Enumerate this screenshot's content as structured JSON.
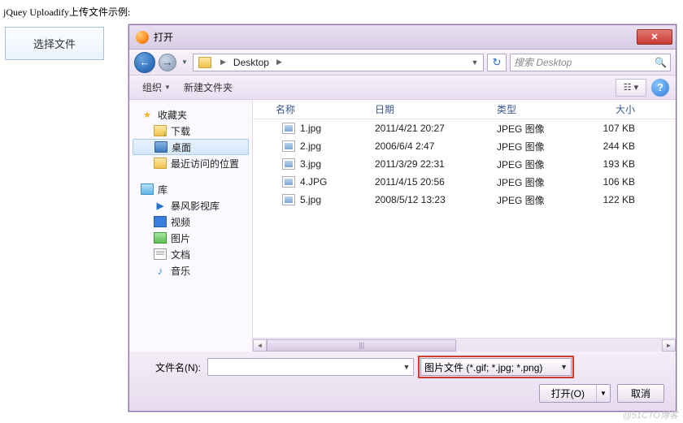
{
  "page_title": "jQuey Uploadify上传文件示例:",
  "select_button": "选择文件",
  "dialog": {
    "title": "打开",
    "close_glyph": "✕",
    "nav_back_glyph": "←",
    "nav_fwd_glyph": "→",
    "breadcrumb": {
      "location": "Desktop"
    },
    "refresh_glyph": "↻",
    "search_placeholder": "搜索 Desktop",
    "search_icon": "🔍"
  },
  "toolbar": {
    "organize": "组织",
    "new_folder": "新建文件夹",
    "view_glyph": "☷ ▾",
    "help_glyph": "?"
  },
  "sidebar": {
    "favorites": {
      "label": "收藏夹",
      "items": [
        {
          "key": "downloads",
          "label": "下载"
        },
        {
          "key": "desktop",
          "label": "桌面",
          "selected": true
        },
        {
          "key": "recent",
          "label": "最近访问的位置"
        }
      ]
    },
    "libraries": {
      "label": "库",
      "items": [
        {
          "key": "storm",
          "label": "暴风影视库"
        },
        {
          "key": "videos",
          "label": "视频"
        },
        {
          "key": "pictures",
          "label": "图片"
        },
        {
          "key": "documents",
          "label": "文档"
        },
        {
          "key": "music",
          "label": "音乐"
        }
      ]
    }
  },
  "columns": {
    "name": "名称",
    "date": "日期",
    "type": "类型",
    "size": "大小"
  },
  "files": [
    {
      "name": "1.jpg",
      "date": "2011/4/21 20:27",
      "type": "JPEG 图像",
      "size": "107 KB"
    },
    {
      "name": "2.jpg",
      "date": "2006/6/4 2:47",
      "type": "JPEG 图像",
      "size": "244 KB"
    },
    {
      "name": "3.jpg",
      "date": "2011/3/29 22:31",
      "type": "JPEG 图像",
      "size": "193 KB"
    },
    {
      "name": "4.JPG",
      "date": "2011/4/15 20:56",
      "type": "JPEG 图像",
      "size": "106 KB"
    },
    {
      "name": "5.jpg",
      "date": "2008/5/12 13:23",
      "type": "JPEG 图像",
      "size": "122 KB"
    }
  ],
  "footer": {
    "filename_label": "文件名(N):",
    "filename_value": "",
    "filter_label": "图片文件 (*.gif; *.jpg; *.png)",
    "open_label": "打开(O)",
    "cancel_label": "取消"
  },
  "scroll_grip": "|||",
  "watermark": "@51CTO博客"
}
